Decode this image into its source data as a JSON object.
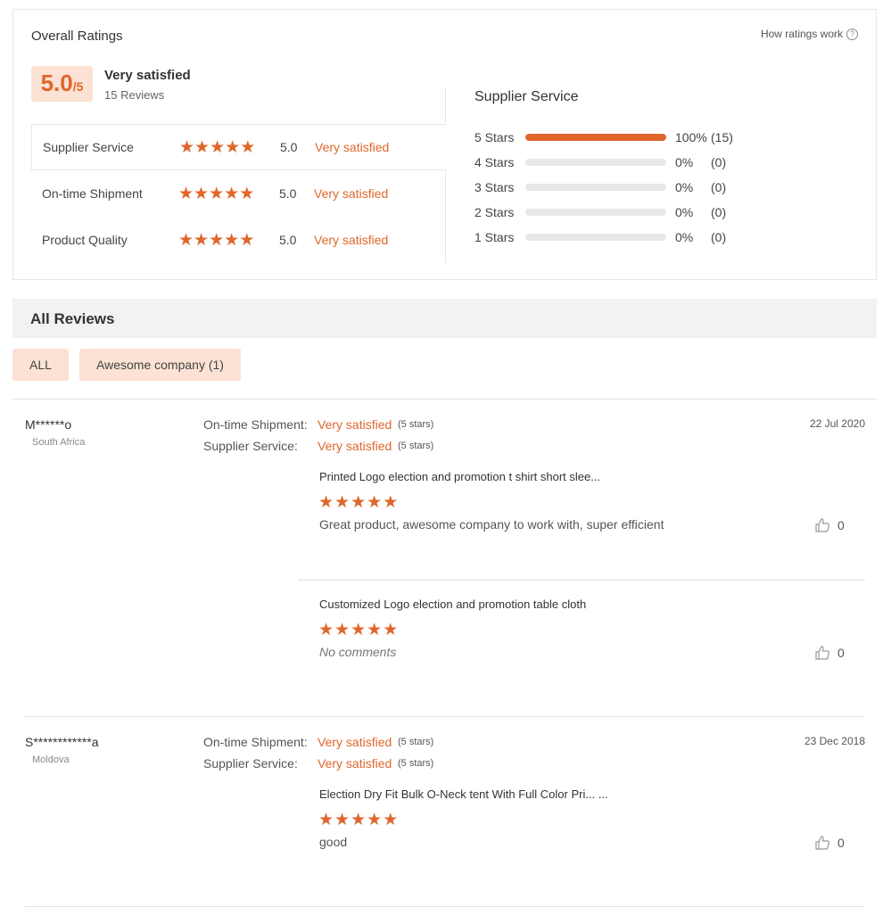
{
  "overall": {
    "title": "Overall Ratings",
    "how_link": "How ratings work",
    "score": "5.0",
    "score_max": "/5",
    "label": "Very satisfied",
    "reviews_count": "15 Reviews",
    "categories": [
      {
        "name": "Supplier Service",
        "value": "5.0",
        "label": "Very satisfied",
        "stars": 5
      },
      {
        "name": "On-time Shipment",
        "value": "5.0",
        "label": "Very satisfied",
        "stars": 5
      },
      {
        "name": "Product Quality",
        "value": "5.0",
        "label": "Very satisfied",
        "stars": 5
      }
    ]
  },
  "distribution": {
    "title": "Supplier Service",
    "rows": [
      {
        "label": "5  Stars",
        "percent": "100%",
        "fraction": 1.0,
        "count": "(15)"
      },
      {
        "label": "4  Stars",
        "percent": "0%",
        "fraction": 0,
        "count": "(0)"
      },
      {
        "label": "3  Stars",
        "percent": "0%",
        "fraction": 0,
        "count": "(0)"
      },
      {
        "label": "2  Stars",
        "percent": "0%",
        "fraction": 0,
        "count": "(0)"
      },
      {
        "label": "1  Stars",
        "percent": "0%",
        "fraction": 0,
        "count": "(0)"
      }
    ]
  },
  "all_reviews": {
    "title": "All Reviews",
    "filters": [
      "ALL",
      "Awesome company (1)"
    ]
  },
  "reviews": [
    {
      "name": "M******o",
      "country": "South Africa",
      "date": "22 Jul 2020",
      "ratings": [
        {
          "label": "On-time Shipment:",
          "value": "Very satisfied",
          "stars": "(5 stars)"
        },
        {
          "label": "Supplier Service:",
          "value": "Very satisfied",
          "stars": "(5 stars)"
        }
      ],
      "products": [
        {
          "title": "Printed Logo election and promotion t shirt short slee...",
          "stars": 5,
          "comment": "Great product, awesome company to work with, super efficient",
          "likes": "0"
        },
        {
          "title": "Customized Logo election and promotion table cloth",
          "stars": 5,
          "comment": "No comments",
          "likes": "0"
        }
      ]
    },
    {
      "name": "S************a",
      "country": "Moldova",
      "date": "23 Dec 2018",
      "ratings": [
        {
          "label": "On-time Shipment:",
          "value": "Very satisfied",
          "stars": "(5 stars)"
        },
        {
          "label": "Supplier Service:",
          "value": "Very satisfied",
          "stars": "(5 stars)"
        }
      ],
      "products": [
        {
          "title": "Election Dry Fit Bulk O-Neck tent With Full Color Pri... ...",
          "stars": 5,
          "comment": "good",
          "likes": "0"
        }
      ]
    }
  ],
  "icons": {
    "star": "star-icon",
    "help": "question-circle-icon",
    "like": "thumbs-up-icon"
  },
  "colors": {
    "accent": "#e0662b",
    "chip_bg": "#fbe2d4",
    "header_bg": "#f1f2f4"
  }
}
